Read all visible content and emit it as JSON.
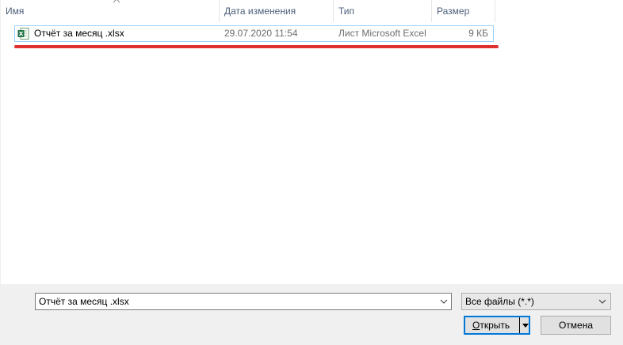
{
  "columns": {
    "name": "Имя",
    "date": "Дата изменения",
    "type": "Тип",
    "size": "Размер"
  },
  "sort": {
    "column": "name",
    "direction": "ascending",
    "icon": "sort-up-chevron-icon"
  },
  "files": [
    {
      "icon": "excel-file-icon",
      "name": "Отчёт за месяц .xlsx",
      "date": "29.07.2020 11:54",
      "type": "Лист Microsoft Excel",
      "size": "9 КБ"
    }
  ],
  "footer": {
    "filename_value": "Отчёт за месяц .xlsx",
    "filter_value": "Все файлы (*.*)",
    "open_label_accel": "О",
    "open_label_rest": "ткрыть",
    "cancel_label": "Отмена"
  },
  "colors": {
    "highlight_border": "#99d1ff",
    "annotation_red": "#e03030",
    "primary_button_border": "#0078d7",
    "header_text": "#4c607a"
  }
}
